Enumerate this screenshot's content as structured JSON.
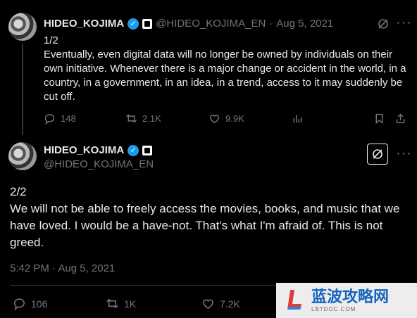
{
  "tweet1": {
    "name": "HIDEO_KOJIMA",
    "handle": "@HIDEO_KOJIMA_EN",
    "separator": "·",
    "date": "Aug 5, 2021",
    "text_line1": "1/2",
    "text_body": "Eventually, even digital data will no longer be owned by individuals on their own initiative. Whenever there is a major change or accident in the world, in a country, in a government, in an idea, in a trend, access to it may suddenly be cut off.",
    "replies": "148",
    "reposts": "2.1K",
    "likes": "9.9K"
  },
  "tweet2": {
    "name": "HIDEO_KOJIMA",
    "handle": "@HIDEO_KOJIMA_EN",
    "text_line1": "2/2",
    "text_body": "We will not be able to freely access the movies, books, and music that we have loved. I would be a have-not. That's what I'm afraid of. This is not greed.",
    "timestamp": "5:42 PM · Aug 5, 2021",
    "replies": "106",
    "reposts": "1K",
    "likes": "7.2K"
  },
  "watermark": {
    "title": "蓝波攻略网",
    "subtitle": "LBTDOC.COM"
  },
  "colors": {
    "background": "#000000",
    "text": "#e7e9ea",
    "muted": "#71767b",
    "verified": "#1d9bf0",
    "watermark_blue": "#1565c0"
  }
}
